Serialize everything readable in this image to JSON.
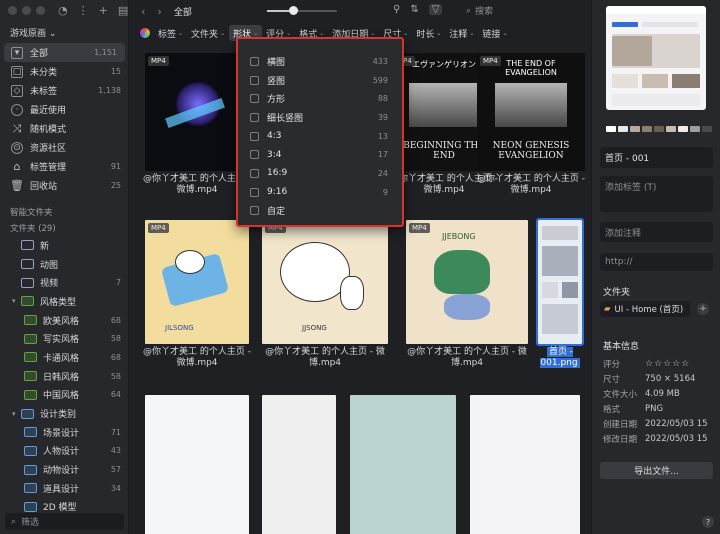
{
  "sidebar": {
    "library": "游戏原画",
    "nav": [
      {
        "label": "全部",
        "count": "1,151",
        "icon": "inbox-icon"
      },
      {
        "label": "未分类",
        "count": "15",
        "icon": "inbox-unsorted-icon"
      },
      {
        "label": "未标签",
        "count": "1,138",
        "icon": "tag-missing-icon"
      },
      {
        "label": "最近使用",
        "count": "",
        "icon": "clock-icon"
      },
      {
        "label": "随机模式",
        "count": "",
        "icon": "shuffle-icon"
      },
      {
        "label": "资源社区",
        "count": "",
        "icon": "community-icon"
      },
      {
        "label": "标签管理",
        "count": "91",
        "icon": "tag-icon"
      },
      {
        "label": "回收站",
        "count": "25",
        "icon": "trash-icon"
      }
    ],
    "smart_folders": "智能文件夹",
    "folders_header": "文件夹 (29)",
    "folders": [
      {
        "label": "新",
        "count": "",
        "color": "plain",
        "caret": ""
      },
      {
        "label": "动图",
        "count": "",
        "color": "plain",
        "caret": ""
      },
      {
        "label": "视频",
        "count": "7",
        "color": "plain",
        "caret": ""
      },
      {
        "label": "风格类型",
        "count": "",
        "color": "green",
        "caret": "▾"
      },
      {
        "label": "欧美风格",
        "count": "68",
        "color": "green",
        "caret": "",
        "indent": true
      },
      {
        "label": "写实风格",
        "count": "58",
        "color": "green",
        "caret": "",
        "indent": true
      },
      {
        "label": "卡通风格",
        "count": "68",
        "color": "green",
        "caret": "",
        "indent": true
      },
      {
        "label": "日韩风格",
        "count": "58",
        "color": "green",
        "caret": "",
        "indent": true
      },
      {
        "label": "中国风格",
        "count": "64",
        "color": "green",
        "caret": "",
        "indent": true
      },
      {
        "label": "设计类别",
        "count": "",
        "color": "blue",
        "caret": "▾"
      },
      {
        "label": "场景设计",
        "count": "71",
        "color": "blue",
        "caret": "",
        "indent": true
      },
      {
        "label": "人物设计",
        "count": "43",
        "color": "blue",
        "caret": "",
        "indent": true
      },
      {
        "label": "动物设计",
        "count": "57",
        "color": "blue",
        "caret": "",
        "indent": true
      },
      {
        "label": "道具设计",
        "count": "34",
        "color": "blue",
        "caret": "",
        "indent": true
      },
      {
        "label": "2D 模型",
        "count": "",
        "color": "blue",
        "caret": "",
        "indent": true
      }
    ],
    "filter_placeholder": "筛选"
  },
  "main": {
    "title": "全部",
    "search_placeholder": "搜索",
    "filters": [
      {
        "label": "标签",
        "active": false
      },
      {
        "label": "文件夹",
        "active": false
      },
      {
        "label": "形状",
        "active": true
      },
      {
        "label": "评分",
        "active": false
      },
      {
        "label": "格式",
        "active": false
      },
      {
        "label": "添加日期",
        "active": false
      },
      {
        "label": "尺寸",
        "active": false
      },
      {
        "label": "时长",
        "active": false
      },
      {
        "label": "注释",
        "active": false
      },
      {
        "label": "链接",
        "active": false
      }
    ],
    "shape_dropdown": [
      {
        "label": "横图",
        "count": "433"
      },
      {
        "label": "竖图",
        "count": "599"
      },
      {
        "label": "方形",
        "count": "88"
      },
      {
        "label": "细长竖图",
        "count": "39"
      },
      {
        "label": "4:3",
        "count": "13"
      },
      {
        "label": "3:4",
        "count": "17"
      },
      {
        "label": "16:9",
        "count": "24"
      },
      {
        "label": "9:16",
        "count": "9"
      },
      {
        "label": "自定",
        "count": ""
      }
    ],
    "items": [
      {
        "badge": "MP4",
        "caption": "@你丫才美工 的个人主页 - 微博.mp4"
      },
      {
        "badge": "",
        "caption": ""
      },
      {
        "badge": "MP4",
        "caption": "@你丫才美工 的个人主页 - 微博.mp4"
      },
      {
        "badge": "MP4",
        "caption": "@你丫才美工 的个人主页 - 微博.mp4"
      },
      {
        "badge": "MP4",
        "caption": "@你丫才美工 的个人主页 - 微博.mp4"
      },
      {
        "badge": "MP4",
        "caption": "@你丫才美工 的个人主页 - 微博.mp4"
      },
      {
        "badge": "MP4",
        "caption": "@你丫才美工 的个人主页 - 微博.mp4"
      },
      {
        "badge": "",
        "caption": "首页 - 001.png"
      }
    ],
    "poster_texts": [
      "THE END OF EVANGELION",
      "NEON GENESIS EVANGELION",
      "BEGINNING THE END",
      "エヴァンゲリオン"
    ],
    "art_texts": [
      "JILSONG",
      "JJSONG",
      "JJEBONG"
    ]
  },
  "right": {
    "name_value": "首页 - 001",
    "tag_placeholder": "添加标签 (T)",
    "note_placeholder": "添加注释",
    "url_placeholder": "http://",
    "folder_label": "文件夹",
    "folder_value": "UI - Home (首页)",
    "info_label": "基本信息",
    "info": [
      {
        "k": "评分",
        "v": "☆☆☆☆☆"
      },
      {
        "k": "尺寸",
        "v": "750 × 5164"
      },
      {
        "k": "文件大小",
        "v": "4.09 MB"
      },
      {
        "k": "格式",
        "v": "PNG"
      },
      {
        "k": "创建日期",
        "v": "2022/05/03 15"
      },
      {
        "k": "修改日期",
        "v": "2022/05/03 15"
      }
    ],
    "export_label": "导出文件...",
    "swatch_colors": [
      "#ffffff",
      "#e8e8ea",
      "#b6aa9e",
      "#8b7d70",
      "#6a5d53",
      "#c8bdb2",
      "#f1ece6",
      "#9c9ea3",
      "#4d4b4a"
    ]
  },
  "colors": {
    "accent": "#2f6fd6",
    "highlight_border": "#d9342b",
    "folder_green": "#5ea83a",
    "folder_blue": "#5aa0e0"
  }
}
